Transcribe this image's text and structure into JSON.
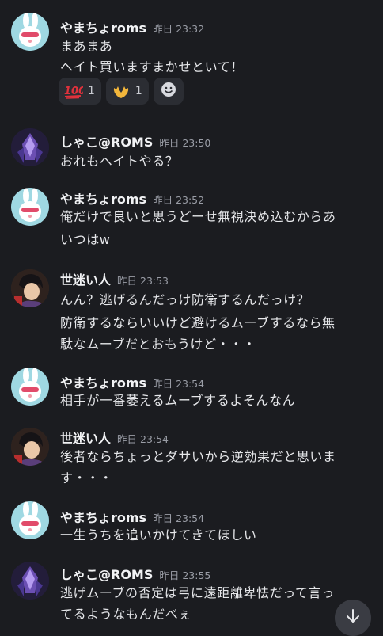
{
  "messages": [
    {
      "author": "やまちょroms",
      "time": "昨日 23:32",
      "lines": [
        "まあまあ",
        "ヘイト買いますまかせといて！"
      ],
      "reactions": [
        {
          "emoji": "hundred-points",
          "count": "1"
        },
        {
          "emoji": "heart-hands",
          "count": "1"
        }
      ]
    },
    {
      "author": "しゃこ@ROMS",
      "time": "昨日 23:50",
      "lines": [
        "おれもヘイトやる？"
      ]
    },
    {
      "author": "やまちょroms",
      "time": "昨日 23:52",
      "lines": [
        "俺だけで良いと思うどーせ無視決め込むからあ",
        "いつはw"
      ]
    },
    {
      "author": "世迷い人",
      "time": "昨日 23:53",
      "lines": [
        "んん？逃げるんだっけ防衛するんだっけ？",
        "防衛するならいいけど避けるムーブするなら無",
        "駄なムーブだとおもうけど・・・"
      ]
    },
    {
      "author": "やまちょroms",
      "time": "昨日 23:54",
      "lines": [
        "相手が一番萎えるムーブするよそんなん"
      ]
    },
    {
      "author": "世迷い人",
      "time": "昨日 23:54",
      "lines": [
        "後者ならちょっとダサいから逆効果だと思いま",
        "す・・・"
      ]
    },
    {
      "author": "やまちょroms",
      "time": "昨日 23:54",
      "lines": [
        "一生うちを追いかけてきてほしい"
      ]
    },
    {
      "author": "しゃこ@ROMS",
      "time": "昨日 23:55",
      "lines": [
        "逃げムーブの否定は弓に遠距離卑怯だって言っ",
        "てるようなもんだべぇ"
      ]
    }
  ],
  "icons": {
    "add_reaction": "smiley-icon",
    "jump": "arrow-down-icon"
  }
}
